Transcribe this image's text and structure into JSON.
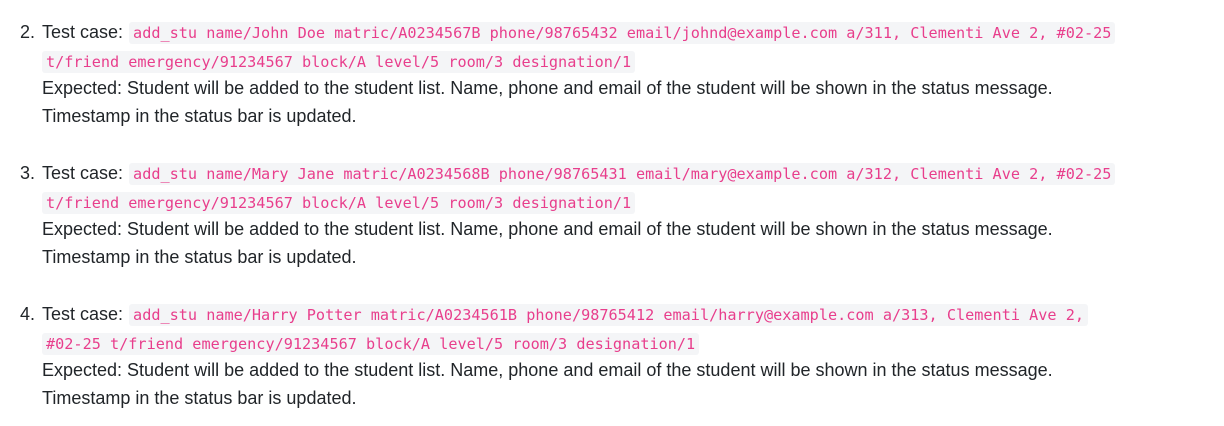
{
  "items": [
    {
      "number": "2.",
      "label": "Test case:",
      "code_line1": "add_stu name/John Doe matric/A0234567B phone/98765432 email/johnd@example.com a/311, Clementi Ave 2, #02-25",
      "code_line2": "t/friend emergency/91234567 block/A level/5 room/3 designation/1",
      "expected_line1": "Expected: Student will be added to the student list. Name, phone and email of the student will be shown in the status message.",
      "expected_line2": "Timestamp in the status bar is updated."
    },
    {
      "number": "3.",
      "label": "Test case:",
      "code_line1": "add_stu name/Mary Jane matric/A0234568B phone/98765431 email/mary@example.com a/312, Clementi Ave 2, #02-25",
      "code_line2": "t/friend emergency/91234567 block/A level/5 room/3 designation/1",
      "expected_line1": "Expected: Student will be added to the student list. Name, phone and email of the student will be shown in the status message.",
      "expected_line2": "Timestamp in the status bar is updated."
    },
    {
      "number": "4.",
      "label": "Test case:",
      "code_line1": "add_stu name/Harry Potter matric/A0234561B phone/98765412 email/harry@example.com a/313, Clementi Ave 2,",
      "code_line2": "#02-25 t/friend emergency/91234567 block/A level/5 room/3 designation/1",
      "expected_line1": "Expected: Student will be added to the student list. Name, phone and email of the student will be shown in the status message.",
      "expected_line2": "Timestamp in the status bar is updated."
    }
  ],
  "colors": {
    "code_text": "#e83e8c",
    "code_background": "#f4f5f7",
    "body_text": "#212529"
  }
}
